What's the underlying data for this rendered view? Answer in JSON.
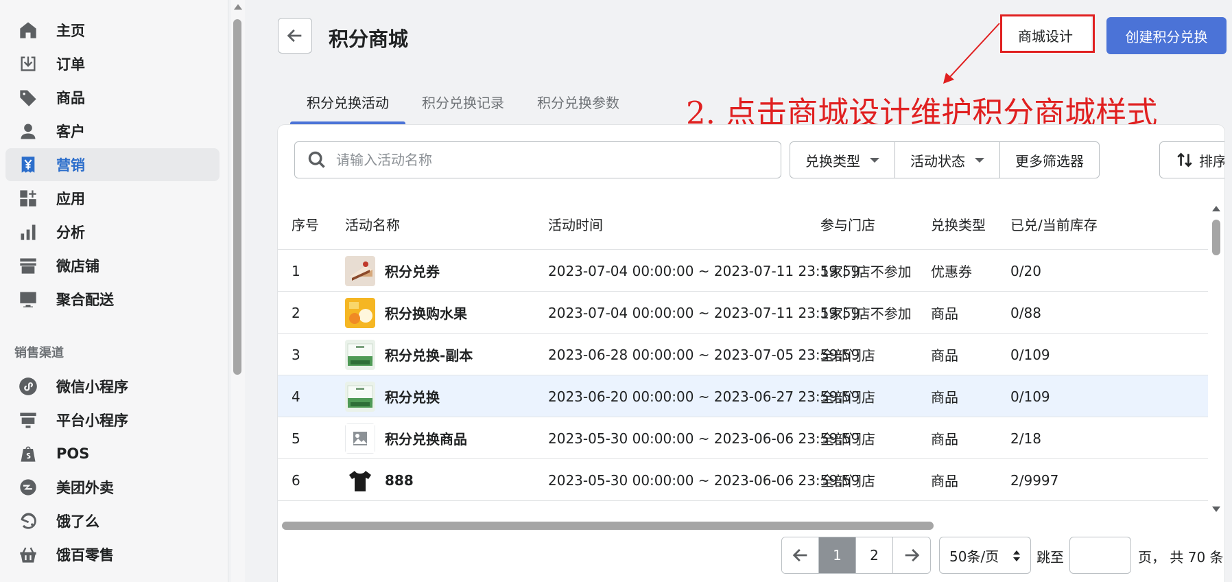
{
  "sidebar": {
    "nav": [
      {
        "label": "主页",
        "icon": "home-icon"
      },
      {
        "label": "订单",
        "icon": "orders-icon"
      },
      {
        "label": "商品",
        "icon": "tag-icon"
      },
      {
        "label": "客户",
        "icon": "person-icon"
      },
      {
        "label": "营销",
        "icon": "yen-icon",
        "active": true
      },
      {
        "label": "应用",
        "icon": "apps-icon"
      },
      {
        "label": "分析",
        "icon": "bar-chart-icon"
      },
      {
        "label": "微店铺",
        "icon": "store-icon"
      },
      {
        "label": "聚合配送",
        "icon": "monitor-icon"
      }
    ],
    "section_title": "销售渠道",
    "channels": [
      {
        "label": "微信小程序",
        "icon": "mini-program-icon"
      },
      {
        "label": "平台小程序",
        "icon": "platform-icon"
      },
      {
        "label": "POS",
        "icon": "shopping-bag-icon"
      },
      {
        "label": "美团外卖",
        "icon": "meituan-icon"
      },
      {
        "label": "饿了么",
        "icon": "eleme-icon"
      },
      {
        "label": "饿百零售",
        "icon": "basket-icon"
      }
    ]
  },
  "header": {
    "title": "积分商城",
    "design_button": "商城设计",
    "create_button": "创建积分兑换"
  },
  "annotation": "2. 点击商城设计维护积分商城样式",
  "tabs": [
    {
      "label": "积分兑换活动",
      "active": true
    },
    {
      "label": "积分兑换记录"
    },
    {
      "label": "积分兑换参数"
    }
  ],
  "toolbar": {
    "search_placeholder": "请输入活动名称",
    "filter_type": "兑换类型",
    "filter_status": "活动状态",
    "more_filters": "更多筛选器",
    "sort": "排序"
  },
  "table": {
    "columns": [
      "序号",
      "活动名称",
      "活动时间",
      "参与门店",
      "兑换类型",
      "已兑/当前库存"
    ],
    "rows": [
      {
        "no": "1",
        "name": "积分兑券",
        "time": "2023-07-04 00:00:00 ~ 2023-07-11 23:59:59",
        "stores": "1家门店不参加",
        "type": "优惠券",
        "stock": "0/20",
        "thumb": "cake"
      },
      {
        "no": "2",
        "name": "积分换购水果",
        "time": "2023-07-04 00:00:00 ~ 2023-07-11 23:59:59",
        "stores": "1家门店不参加",
        "type": "商品",
        "stock": "0/88",
        "thumb": "fruit"
      },
      {
        "no": "3",
        "name": "积分兑换-副本",
        "time": "2023-06-28 00:00:00 ~ 2023-07-05 23:59:59",
        "stores": "全部门店",
        "type": "商品",
        "stock": "0/109",
        "thumb": "box"
      },
      {
        "no": "4",
        "name": "积分兑换",
        "time": "2023-06-20 00:00:00 ~ 2023-06-27 23:59:59",
        "stores": "全部门店",
        "type": "商品",
        "stock": "0/109",
        "thumb": "box",
        "highlight": true
      },
      {
        "no": "5",
        "name": "积分兑换商品",
        "time": "2023-05-30 00:00:00 ~ 2023-06-06 23:59:59",
        "stores": "全部门店",
        "type": "商品",
        "stock": "2/18",
        "thumb": "placeholder"
      },
      {
        "no": "6",
        "name": "888",
        "time": "2023-05-30 00:00:00 ~ 2023-06-06 23:59:59",
        "stores": "全部门店",
        "type": "商品",
        "stock": "2/9997",
        "thumb": "shirt"
      }
    ]
  },
  "pagination": {
    "pages": [
      "1",
      "2"
    ],
    "current": "1",
    "per_page": "50条/页",
    "jump_label": "跳至",
    "jump_value": "",
    "total_label": "页， 共 70 条"
  },
  "colors": {
    "accent": "#4b73d7",
    "annotation": "#e02020",
    "active_nav": "#2c6ecb"
  }
}
